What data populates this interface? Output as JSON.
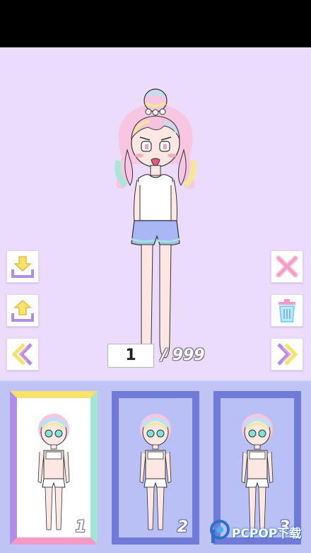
{
  "editor": {
    "page_current": "1",
    "page_total": "/ 999"
  },
  "save_slots": [
    {
      "number": "1",
      "selected": true
    },
    {
      "number": "2",
      "selected": false
    },
    {
      "number": "3",
      "selected": false
    }
  ],
  "watermark": {
    "text": "PCPOP下载"
  },
  "colors": {
    "background": "#ecdcfb",
    "tray": "#bfc4f5",
    "slot_frame": "#6f7bd6",
    "accent_yellow": "#f6e36a",
    "accent_purple": "#b08de8",
    "accent_pink": "#f59ac7",
    "accent_blue": "#7fd3f2"
  },
  "icons": [
    "save-down-icon",
    "upload-icon",
    "previous-page-icon",
    "close-icon",
    "trash-icon",
    "next-page-icon",
    "pcpop-logo"
  ]
}
